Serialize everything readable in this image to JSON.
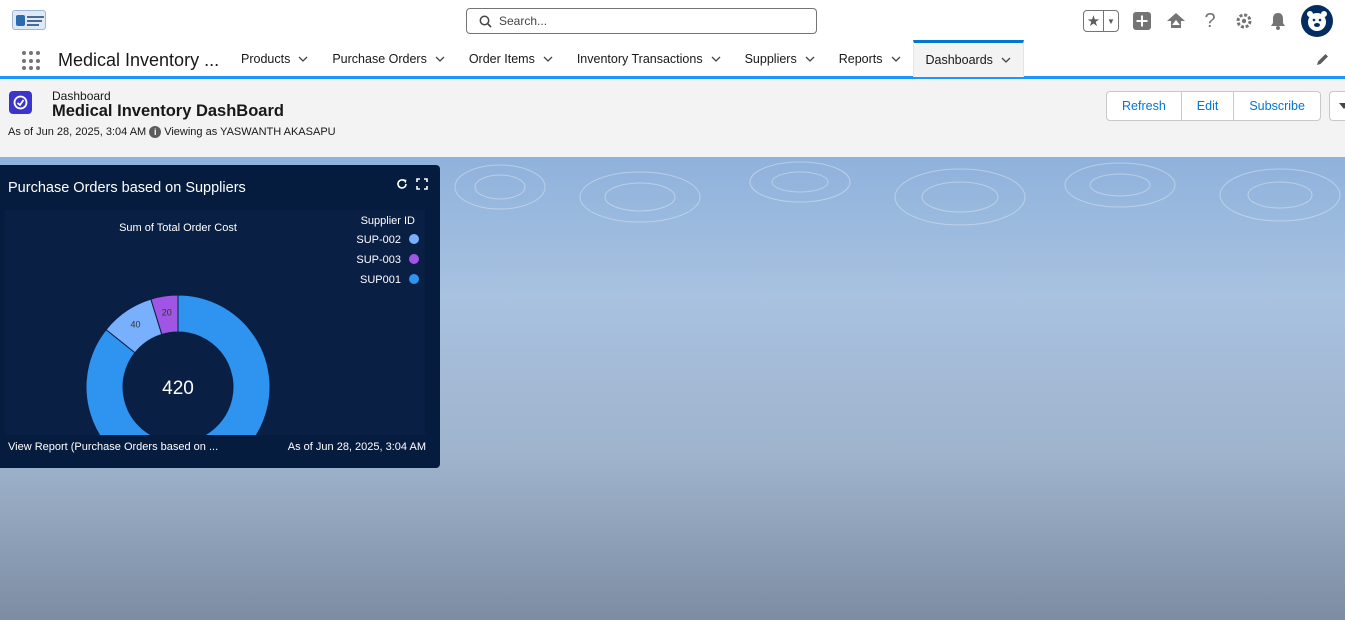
{
  "header": {
    "search_placeholder": "Search..."
  },
  "nav": {
    "app_name": "Medical Inventory ...",
    "tabs": [
      {
        "label": "Products"
      },
      {
        "label": "Purchase Orders"
      },
      {
        "label": "Order Items"
      },
      {
        "label": "Inventory Transactions"
      },
      {
        "label": "Suppliers"
      },
      {
        "label": "Reports"
      },
      {
        "label": "Dashboards",
        "active": true
      }
    ]
  },
  "dashboard": {
    "kind": "Dashboard",
    "title": "Medical Inventory DashBoard",
    "as_of": "As of Jun 28, 2025, 3:04 AM",
    "viewing_as": "Viewing as YASWANTH AKASAPU",
    "buttons": {
      "refresh": "Refresh",
      "edit": "Edit",
      "subscribe": "Subscribe"
    }
  },
  "widget": {
    "title": "Purchase Orders based on Suppliers",
    "footer_link": "View Report (Purchase Orders based on ...",
    "footer_date": "As of Jun 28, 2025, 3:04 AM"
  },
  "chart_data": {
    "type": "pie",
    "subtype": "donut",
    "title": "Sum of Total Order Cost",
    "legend_title": "Supplier ID",
    "legend_position": "top-right",
    "total": 420,
    "series": [
      {
        "name": "SUP-002",
        "value": 40,
        "color": "#78b0fd"
      },
      {
        "name": "SUP-003",
        "value": 20,
        "color": "#a155e5"
      },
      {
        "name": "SUP001",
        "value": 360,
        "color": "#2f93f0"
      }
    ]
  },
  "colors": {
    "brand": "#0176d3",
    "dashboard_icon": "#3c35cc",
    "widget_bg": "#061c3f"
  }
}
